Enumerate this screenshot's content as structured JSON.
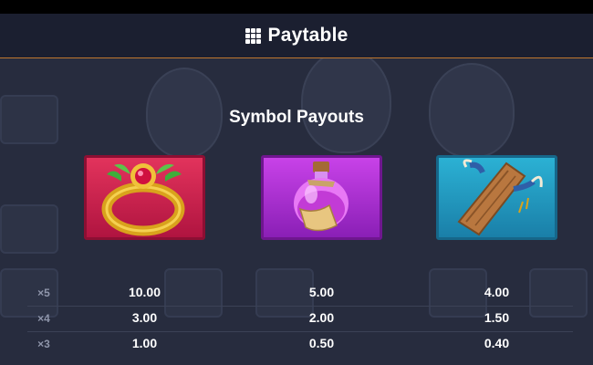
{
  "header": {
    "title": "Paytable",
    "icon": "grid-menu-icon"
  },
  "section": {
    "title": "Symbol Payouts"
  },
  "symbols": [
    {
      "name": "ring",
      "icon": "ruby-ring-icon",
      "color": "#d42651"
    },
    {
      "name": "potion",
      "icon": "potion-bottle-icon",
      "color": "#b232d8"
    },
    {
      "name": "wood",
      "icon": "wooden-plank-icon",
      "color": "#1f9ac3"
    }
  ],
  "payouts": [
    {
      "multiplier": "×5",
      "values": [
        "10.00",
        "5.00",
        "4.00"
      ]
    },
    {
      "multiplier": "×4",
      "values": [
        "3.00",
        "2.00",
        "1.50"
      ]
    },
    {
      "multiplier": "×3",
      "values": [
        "1.00",
        "0.50",
        "0.40"
      ]
    }
  ],
  "colors": {
    "accent_line": "#c0772e",
    "background": "#272c3e",
    "header": "#1b1f30",
    "multiplier_text": "#8f96ab"
  }
}
